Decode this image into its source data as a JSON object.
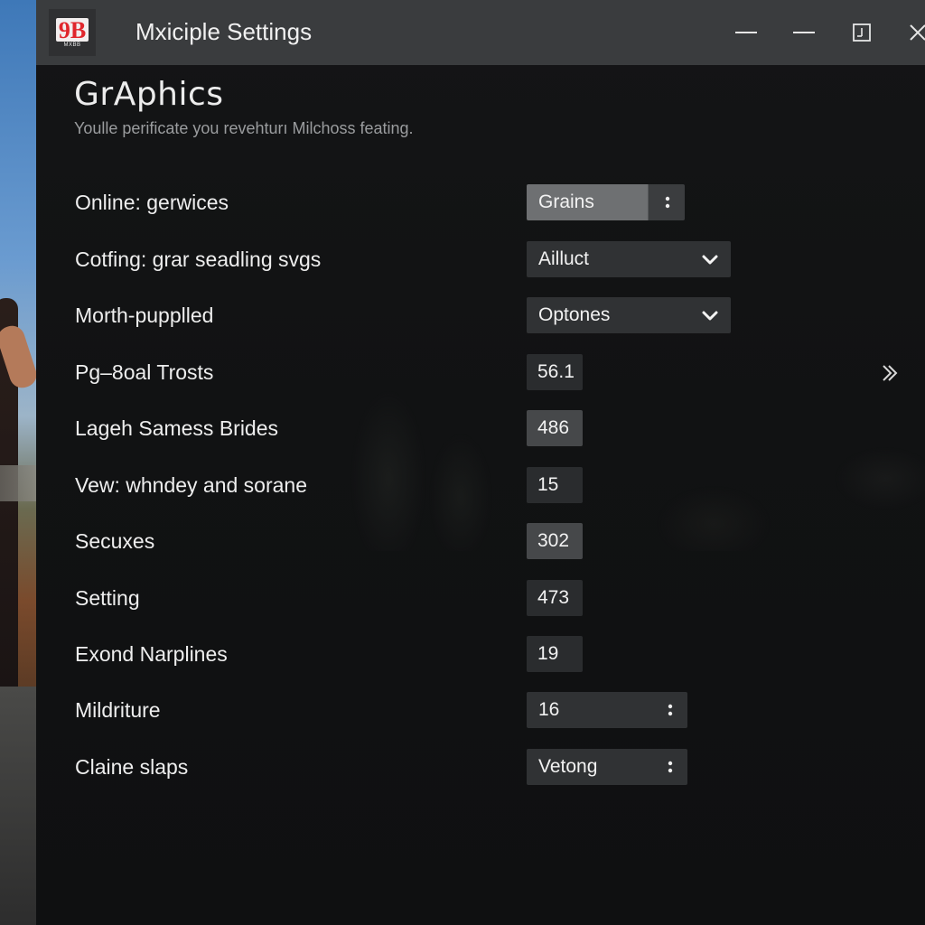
{
  "window": {
    "title": "Mxiciple Settings",
    "logo_text": "9B",
    "logo_sub": "MXBB"
  },
  "page": {
    "heading": "GrAphics",
    "subheading": "Youlle perificate you revehturı Milchoss feating."
  },
  "settings": [
    {
      "label": "Online: gerwices",
      "control": "spinner",
      "value": "Grains"
    },
    {
      "label": "Cotfing: grar seadling svgs",
      "control": "dropdown",
      "value": "Ailluct"
    },
    {
      "label": "Morth-pupplled",
      "control": "dropdown",
      "value": "Optones"
    },
    {
      "label": "Pg–8oal Trosts",
      "control": "number",
      "value": "56.1"
    },
    {
      "label": "Lageh Samess Brides",
      "control": "number",
      "value": "486"
    },
    {
      "label": "Vew: whndey and sorane",
      "control": "number",
      "value": "15"
    },
    {
      "label": "Secuxes",
      "control": "number",
      "value": "302"
    },
    {
      "label": "Setting",
      "control": "number",
      "value": "473"
    },
    {
      "label": "Exond Narplines",
      "control": "number",
      "value": "19"
    },
    {
      "label": "Mildriture",
      "control": "spinner",
      "value": "16"
    },
    {
      "label": "Claine slaps",
      "control": "spinner",
      "value": "Vetong"
    }
  ],
  "colors": {
    "titlebar": "#3a3c3e",
    "panel": "#111213",
    "logo_red": "#e0262c",
    "control_bg": "#303234",
    "highlight": "#6e7072"
  },
  "icons": {
    "minimize": "minimize-icon",
    "maximize": "maximize-icon",
    "restore": "restore-icon",
    "close": "close-icon",
    "dropdown": "chevron-down-icon",
    "spinner": "kebab-spinner-icon",
    "side": "double-chevron-right-icon"
  }
}
